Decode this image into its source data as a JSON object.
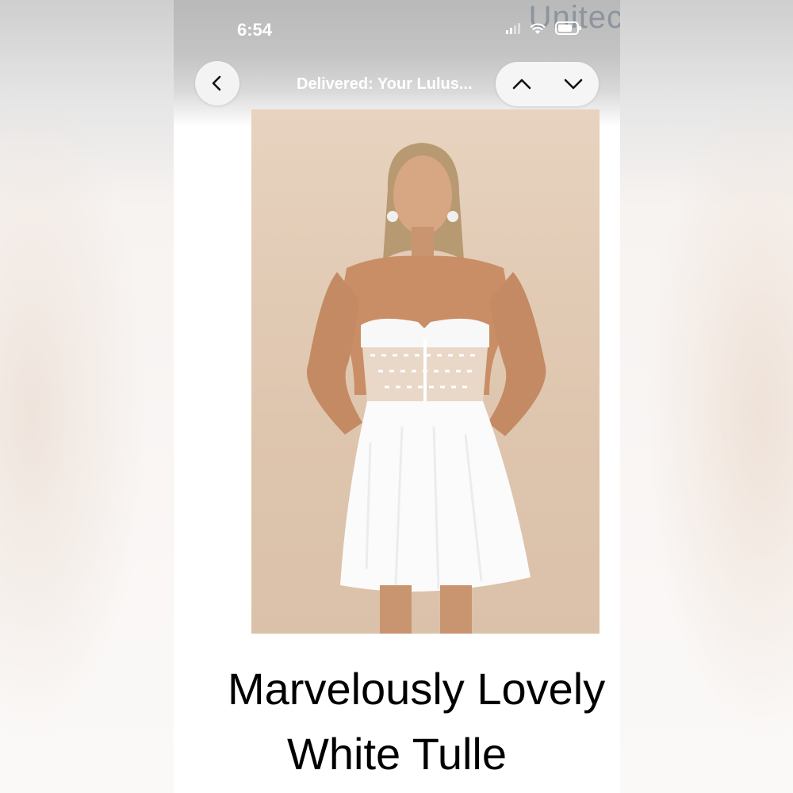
{
  "status_bar": {
    "time": "6:54",
    "icons": [
      "cellular-signal-icon",
      "wifi-icon",
      "battery-icon"
    ]
  },
  "background_text": "Unitec",
  "header": {
    "back_icon": "chevron-left-icon",
    "title": "Delivered: Your Lulus...",
    "prev_icon": "chevron-up-icon",
    "next_icon": "chevron-down-icon"
  },
  "product": {
    "image": "white strapless corset mini dress with tulle skirt",
    "name_line1": "Marvelously Lovely",
    "name_line2": "White Tulle"
  },
  "colors": {
    "image_background": "#e2cdb8",
    "dress": "#fbfbfb",
    "skin": "#c98e66",
    "text": "#000000"
  }
}
